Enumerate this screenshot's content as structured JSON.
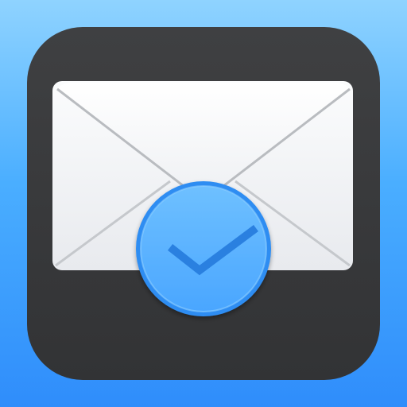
{
  "icon": {
    "name": "mail-with-checkmark-app-icon",
    "background_gradient": [
      "#8fd3ff",
      "#4aaeff",
      "#2f8dfb"
    ],
    "tile_color": "#3a3b3d",
    "envelope_color": "#f2f4f6",
    "envelope_fold_color": "#b9bcc0",
    "badge_color": "#52acff",
    "badge_ring_color": "#2f8df2",
    "checkmark_color": "#2a80e0",
    "icons": [
      "envelope-icon",
      "checkmark-icon"
    ]
  }
}
